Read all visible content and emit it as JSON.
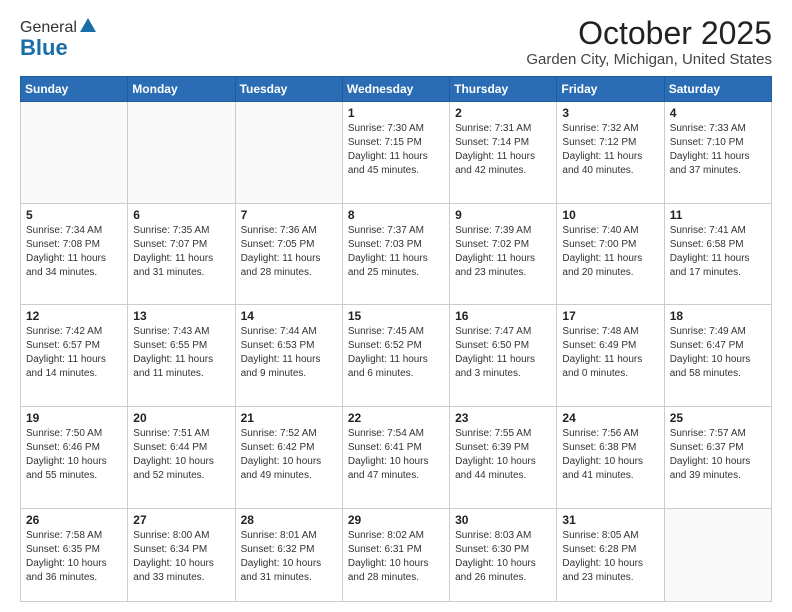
{
  "header": {
    "logo_general": "General",
    "logo_blue": "Blue",
    "month_title": "October 2025",
    "location": "Garden City, Michigan, United States"
  },
  "weekdays": [
    "Sunday",
    "Monday",
    "Tuesday",
    "Wednesday",
    "Thursday",
    "Friday",
    "Saturday"
  ],
  "weeks": [
    [
      {
        "day": "",
        "info": ""
      },
      {
        "day": "",
        "info": ""
      },
      {
        "day": "",
        "info": ""
      },
      {
        "day": "1",
        "info": "Sunrise: 7:30 AM\nSunset: 7:15 PM\nDaylight: 11 hours\nand 45 minutes."
      },
      {
        "day": "2",
        "info": "Sunrise: 7:31 AM\nSunset: 7:14 PM\nDaylight: 11 hours\nand 42 minutes."
      },
      {
        "day": "3",
        "info": "Sunrise: 7:32 AM\nSunset: 7:12 PM\nDaylight: 11 hours\nand 40 minutes."
      },
      {
        "day": "4",
        "info": "Sunrise: 7:33 AM\nSunset: 7:10 PM\nDaylight: 11 hours\nand 37 minutes."
      }
    ],
    [
      {
        "day": "5",
        "info": "Sunrise: 7:34 AM\nSunset: 7:08 PM\nDaylight: 11 hours\nand 34 minutes."
      },
      {
        "day": "6",
        "info": "Sunrise: 7:35 AM\nSunset: 7:07 PM\nDaylight: 11 hours\nand 31 minutes."
      },
      {
        "day": "7",
        "info": "Sunrise: 7:36 AM\nSunset: 7:05 PM\nDaylight: 11 hours\nand 28 minutes."
      },
      {
        "day": "8",
        "info": "Sunrise: 7:37 AM\nSunset: 7:03 PM\nDaylight: 11 hours\nand 25 minutes."
      },
      {
        "day": "9",
        "info": "Sunrise: 7:39 AM\nSunset: 7:02 PM\nDaylight: 11 hours\nand 23 minutes."
      },
      {
        "day": "10",
        "info": "Sunrise: 7:40 AM\nSunset: 7:00 PM\nDaylight: 11 hours\nand 20 minutes."
      },
      {
        "day": "11",
        "info": "Sunrise: 7:41 AM\nSunset: 6:58 PM\nDaylight: 11 hours\nand 17 minutes."
      }
    ],
    [
      {
        "day": "12",
        "info": "Sunrise: 7:42 AM\nSunset: 6:57 PM\nDaylight: 11 hours\nand 14 minutes."
      },
      {
        "day": "13",
        "info": "Sunrise: 7:43 AM\nSunset: 6:55 PM\nDaylight: 11 hours\nand 11 minutes."
      },
      {
        "day": "14",
        "info": "Sunrise: 7:44 AM\nSunset: 6:53 PM\nDaylight: 11 hours\nand 9 minutes."
      },
      {
        "day": "15",
        "info": "Sunrise: 7:45 AM\nSunset: 6:52 PM\nDaylight: 11 hours\nand 6 minutes."
      },
      {
        "day": "16",
        "info": "Sunrise: 7:47 AM\nSunset: 6:50 PM\nDaylight: 11 hours\nand 3 minutes."
      },
      {
        "day": "17",
        "info": "Sunrise: 7:48 AM\nSunset: 6:49 PM\nDaylight: 11 hours\nand 0 minutes."
      },
      {
        "day": "18",
        "info": "Sunrise: 7:49 AM\nSunset: 6:47 PM\nDaylight: 10 hours\nand 58 minutes."
      }
    ],
    [
      {
        "day": "19",
        "info": "Sunrise: 7:50 AM\nSunset: 6:46 PM\nDaylight: 10 hours\nand 55 minutes."
      },
      {
        "day": "20",
        "info": "Sunrise: 7:51 AM\nSunset: 6:44 PM\nDaylight: 10 hours\nand 52 minutes."
      },
      {
        "day": "21",
        "info": "Sunrise: 7:52 AM\nSunset: 6:42 PM\nDaylight: 10 hours\nand 49 minutes."
      },
      {
        "day": "22",
        "info": "Sunrise: 7:54 AM\nSunset: 6:41 PM\nDaylight: 10 hours\nand 47 minutes."
      },
      {
        "day": "23",
        "info": "Sunrise: 7:55 AM\nSunset: 6:39 PM\nDaylight: 10 hours\nand 44 minutes."
      },
      {
        "day": "24",
        "info": "Sunrise: 7:56 AM\nSunset: 6:38 PM\nDaylight: 10 hours\nand 41 minutes."
      },
      {
        "day": "25",
        "info": "Sunrise: 7:57 AM\nSunset: 6:37 PM\nDaylight: 10 hours\nand 39 minutes."
      }
    ],
    [
      {
        "day": "26",
        "info": "Sunrise: 7:58 AM\nSunset: 6:35 PM\nDaylight: 10 hours\nand 36 minutes."
      },
      {
        "day": "27",
        "info": "Sunrise: 8:00 AM\nSunset: 6:34 PM\nDaylight: 10 hours\nand 33 minutes."
      },
      {
        "day": "28",
        "info": "Sunrise: 8:01 AM\nSunset: 6:32 PM\nDaylight: 10 hours\nand 31 minutes."
      },
      {
        "day": "29",
        "info": "Sunrise: 8:02 AM\nSunset: 6:31 PM\nDaylight: 10 hours\nand 28 minutes."
      },
      {
        "day": "30",
        "info": "Sunrise: 8:03 AM\nSunset: 6:30 PM\nDaylight: 10 hours\nand 26 minutes."
      },
      {
        "day": "31",
        "info": "Sunrise: 8:05 AM\nSunset: 6:28 PM\nDaylight: 10 hours\nand 23 minutes."
      },
      {
        "day": "",
        "info": ""
      }
    ]
  ]
}
